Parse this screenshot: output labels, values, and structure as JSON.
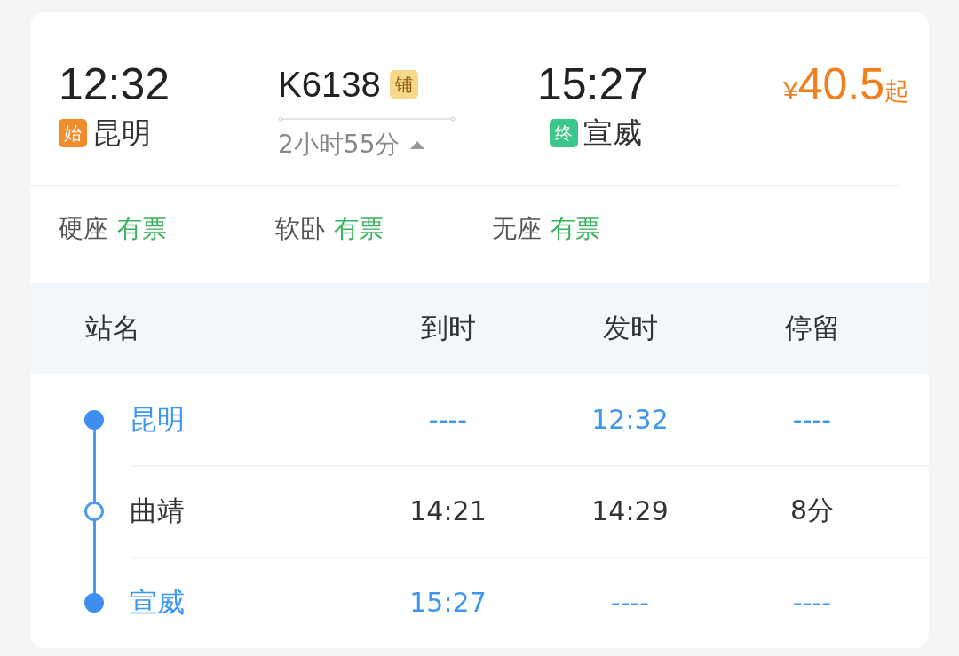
{
  "train": {
    "departure_time": "12:32",
    "departure_badge": "始",
    "departure_station": "昆明",
    "number": "K6138",
    "berth_badge": "铺",
    "duration": "2小时55分",
    "expanded": true,
    "arrival_time": "15:27",
    "arrival_badge": "终",
    "arrival_station": "宣威",
    "price_symbol": "¥",
    "price": "40.5",
    "price_suffix": "起"
  },
  "seats": [
    {
      "type": "硬座",
      "status": "有票"
    },
    {
      "type": "软卧",
      "status": "有票"
    },
    {
      "type": "无座",
      "status": "有票"
    }
  ],
  "timetable": {
    "columns": [
      "站名",
      "到时",
      "发时",
      "停留"
    ],
    "rows": [
      {
        "kind": "endpoint",
        "station": "昆明",
        "arrive": "----",
        "depart": "12:32",
        "stay": "----"
      },
      {
        "kind": "stop",
        "station": "曲靖",
        "arrive": "14:21",
        "depart": "14:29",
        "stay": "8分"
      },
      {
        "kind": "endpoint",
        "station": "宣威",
        "arrive": "15:27",
        "depart": "----",
        "stay": "----"
      }
    ]
  }
}
